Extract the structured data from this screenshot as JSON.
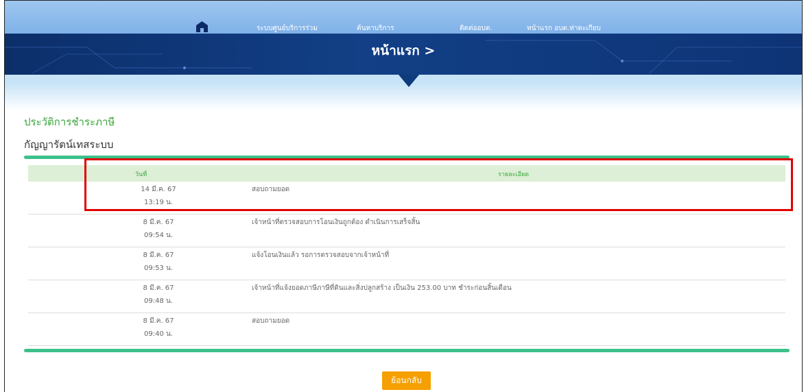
{
  "nav": {
    "home_icon": "home-icon",
    "items": [
      "ระบบศูนย์บริการร่วม",
      "ค้นหาบริการ",
      "ติดต่ออบต.",
      "หน้าแรก อบต.ท่าตะเกียบ"
    ]
  },
  "banner": {
    "title": "หน้าแรก >"
  },
  "section": {
    "title": "ประวัติการชำระภาษี",
    "owner": "กัญญารัตน์เทสระบบ"
  },
  "table": {
    "headers": {
      "date": "วันที่",
      "detail": "รายละเอียด"
    },
    "rows": [
      {
        "date": "14 มี.ค. 67",
        "time": "13:19 น.",
        "detail": "สอบถามยอด"
      },
      {
        "date": "8 มี.ค. 67",
        "time": "09:54 น.",
        "detail": "เจ้าหน้าที่ตรวจสอบการโอนเงินถูกต้อง ดำเนินการเสร็จสิ้น"
      },
      {
        "date": "8 มี.ค. 67",
        "time": "09:53 น.",
        "detail": "แจ้งโอนเงินแล้ว รอการตรวจสอบจากเจ้าหน้าที่"
      },
      {
        "date": "8 มี.ค. 67",
        "time": "09:48 น.",
        "detail": "เจ้าหน้าที่แจ้งยอดภาษีภาษีที่ดินและสิ่งปลูกสร้าง เป็นเงิน 253.00 บาท ชำระก่อนสิ้นเดือน"
      },
      {
        "date": "8 มี.ค. 67",
        "time": "09:40 น.",
        "detail": "สอบถามยอด"
      }
    ]
  },
  "actions": {
    "back_label": "ย้อนกลับ"
  },
  "colors": {
    "accent_green": "#3aa63a",
    "card_border": "#3cc08a",
    "header_bg": "#ddefd6",
    "button": "#f5a000",
    "highlight": "#e00000",
    "banner": "#123f86"
  }
}
